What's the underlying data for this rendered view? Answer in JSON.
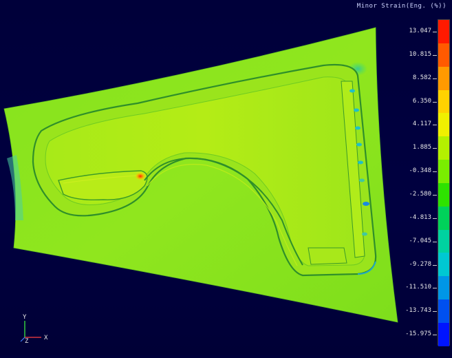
{
  "legend": {
    "title": "Minor Strain(Eng. (%))",
    "labels": [
      "13.047",
      "10.815",
      "8.582",
      "6.350",
      "4.117",
      "1.885",
      "-0.348",
      "-2.580",
      "-4.813",
      "-7.045",
      "-9.278",
      "-11.510",
      "-13.743",
      "-15.975"
    ],
    "colors": [
      "#ff1a00",
      "#ff5a00",
      "#ff9a00",
      "#ffd200",
      "#f0f000",
      "#b4f000",
      "#7aee00",
      "#2ee200",
      "#00d25a",
      "#00d2a0",
      "#00c8d2",
      "#0096e6",
      "#0050f0",
      "#0014ff"
    ]
  },
  "axes": {
    "x_label": "X",
    "y_label": "Y",
    "z_label": "Z"
  },
  "part": {
    "base_color": "#8ee61e"
  }
}
